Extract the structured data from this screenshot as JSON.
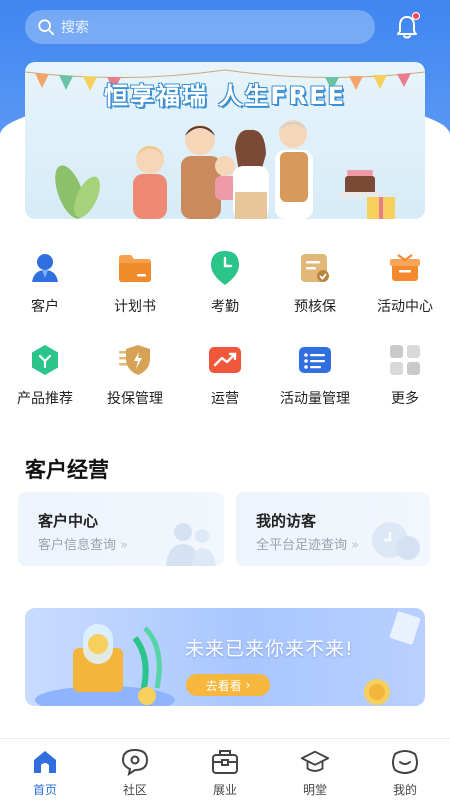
{
  "header": {
    "search_placeholder": "搜索",
    "accent_color": "#3f86f0",
    "notification_dot": true
  },
  "banner": {
    "title": "恒享福瑞 人生FREE"
  },
  "quick_actions": [
    {
      "label": "客户",
      "icon": "customer-icon",
      "color": "#2f6fe0"
    },
    {
      "label": "计划书",
      "icon": "folder-icon",
      "color": "#f08a2b"
    },
    {
      "label": "考勤",
      "icon": "location-clock-icon",
      "color": "#2bc48a"
    },
    {
      "label": "预核保",
      "icon": "check-document-icon",
      "color": "#d6a356"
    },
    {
      "label": "活动中心",
      "icon": "gift-icon",
      "color": "#f5892d"
    },
    {
      "label": "产品推荐",
      "icon": "product-icon",
      "color": "#2bc48a"
    },
    {
      "label": "投保管理",
      "icon": "lightning-shield-icon",
      "color": "#d6a356"
    },
    {
      "label": "运营",
      "icon": "trend-icon",
      "color": "#f0573a"
    },
    {
      "label": "活动量管理",
      "icon": "list-icon",
      "color": "#2f6fe0"
    },
    {
      "label": "更多",
      "icon": "grid-icon",
      "color": "#bfbfbf"
    }
  ],
  "customer_ops": {
    "title": "客户经营",
    "cards": [
      {
        "title": "客户中心",
        "subtitle": "客户信息查询"
      },
      {
        "title": "我的访客",
        "subtitle": "全平台足迹查询"
      }
    ]
  },
  "promo": {
    "text": "未来已来你来不来!",
    "button_label": "去看看"
  },
  "bottom_nav": [
    {
      "label": "首页",
      "icon": "home-icon",
      "active": true
    },
    {
      "label": "社区",
      "icon": "community-icon",
      "active": false
    },
    {
      "label": "展业",
      "icon": "briefcase-icon",
      "active": false
    },
    {
      "label": "明堂",
      "icon": "graduation-cap-icon",
      "active": false
    },
    {
      "label": "我的",
      "icon": "profile-icon",
      "active": false
    }
  ]
}
